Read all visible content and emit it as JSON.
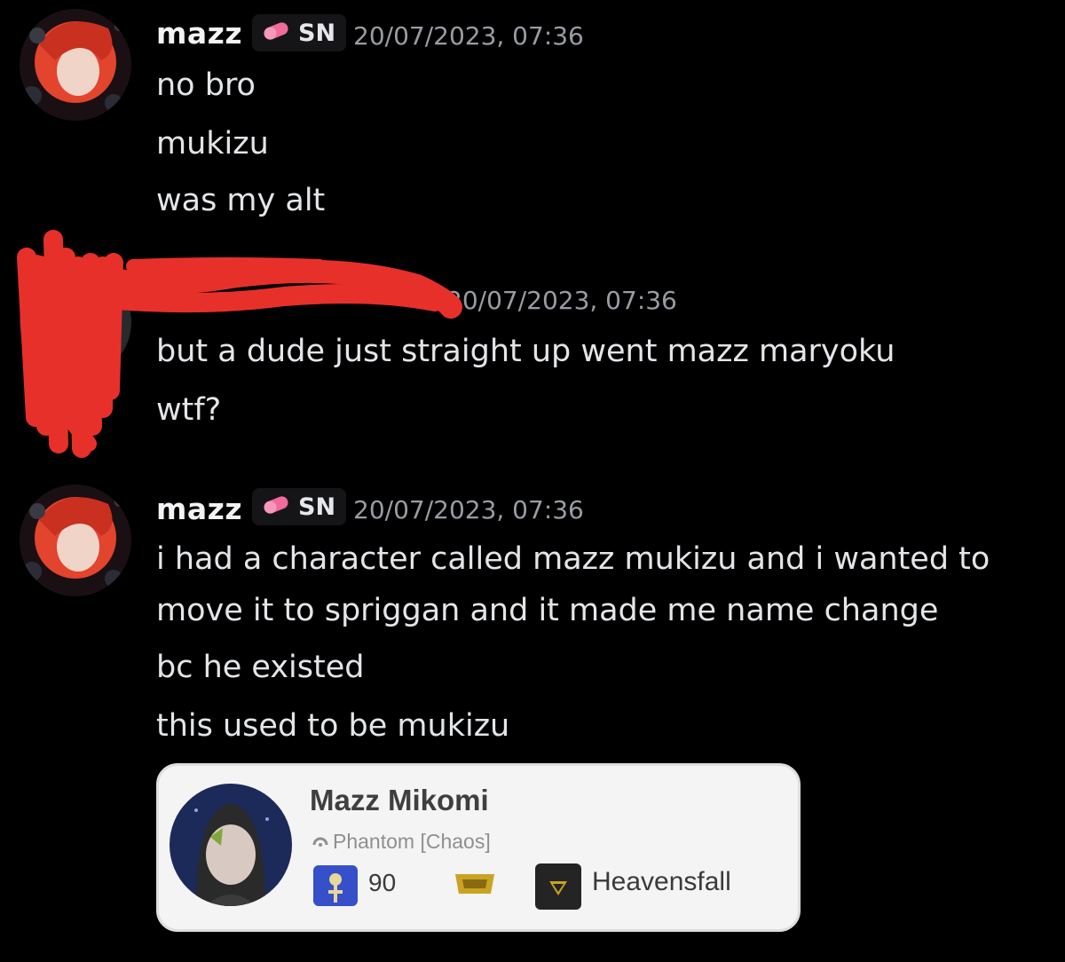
{
  "messages": [
    {
      "username": "mazz",
      "tag": "SN",
      "timestamp": "20/07/2023, 07:36",
      "lines": [
        "no bro",
        "mukizu",
        "was my alt"
      ]
    },
    {
      "username": "",
      "timestamp": "20/07/2023, 07:36",
      "lines": [
        "but a dude just straight up went mazz maryoku",
        "wtf?"
      ]
    },
    {
      "username": "mazz",
      "tag": "SN",
      "timestamp": "20/07/2023, 07:36",
      "lines": [
        "i had a character called mazz mukizu and i wanted to",
        "move it to spriggan and it made me name change",
        "bc he existed",
        "this used to be mukizu"
      ]
    }
  ],
  "embed_card": {
    "character_name": "Mazz Mikomi",
    "world": "Phantom [Chaos]",
    "level": "90",
    "free_company": "Heavensfall"
  },
  "colors": {
    "background": "#000000",
    "tag_icon": "#f06a9a",
    "redaction": "#e8302a",
    "job_icon": "#3550c9"
  },
  "icons": {
    "tag_icon": "pink-pill-icon",
    "world_icon": "home-world-icon",
    "job_icon": "astrologian-job-icon",
    "fc_badge": "free-company-badge-icon",
    "fc_crest": "free-company-crest-icon"
  }
}
